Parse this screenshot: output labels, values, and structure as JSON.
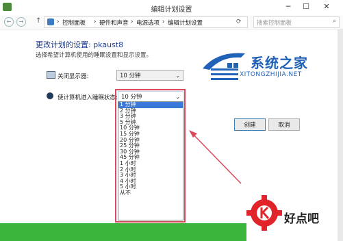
{
  "window": {
    "title": "编辑计划设置",
    "minimize": "─",
    "maximize": "☐",
    "close": "✕"
  },
  "nav": {
    "back": "←",
    "forward": "→",
    "up": "↑",
    "breadcrumb": [
      "控制面板",
      "硬件和声音",
      "电源选项",
      "编辑计划设置"
    ],
    "separator": "›",
    "refresh": "⟳",
    "search_placeholder": "搜索控制面板"
  },
  "main": {
    "title": "更改计划的设置: pkaust8",
    "subtitle": "选择希望计算机使用的睡眠设置和显示设置。",
    "display_label": "关闭显示器:",
    "display_value": "10 分钟",
    "sleep_label": "使计算机进入睡眠状态:",
    "sleep_value": "10 分钟"
  },
  "dropdown": {
    "options": [
      "1 分钟",
      "2 分钟",
      "3 分钟",
      "5 分钟",
      "10 分钟",
      "15 分钟",
      "20 分钟",
      "25 分钟",
      "30 分钟",
      "45 分钟",
      "1 小时",
      "2 小时",
      "3 小时",
      "4 小时",
      "5 小时",
      "从不"
    ],
    "selected_index": 0
  },
  "buttons": {
    "create": "创建",
    "cancel": "取消"
  },
  "watermark": {
    "name": "系统之家",
    "url": "XITONGZHIJIA.NET"
  },
  "brand": {
    "name": "好点吧"
  },
  "colors": {
    "title_blue": "#1e3c8c",
    "highlight_red": "#d94a5c",
    "selection_blue": "#3b79d8",
    "green_bar": "#3bb53b",
    "logo_red": "#e0242a"
  }
}
